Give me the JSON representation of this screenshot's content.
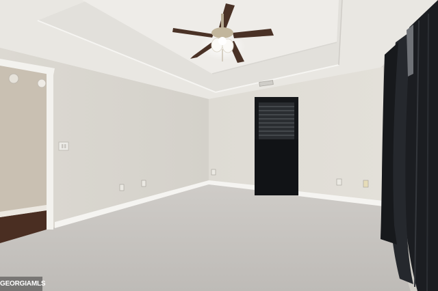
{
  "photo": {
    "subject": "empty-bedroom",
    "colors": {
      "ceiling": "#ebe9e4",
      "wall": "#dedbd4",
      "wall_shadow": "#d3d0c9",
      "carpet": "#c6c3bf",
      "trim": "#f7f6f3",
      "curtain": "#1c1e22",
      "fan_blade": "#4a3226",
      "hallway": "#c9c0b2",
      "hall_floor": "#4a2e22"
    }
  },
  "watermark": {
    "text": "GEORGIAMLS"
  }
}
